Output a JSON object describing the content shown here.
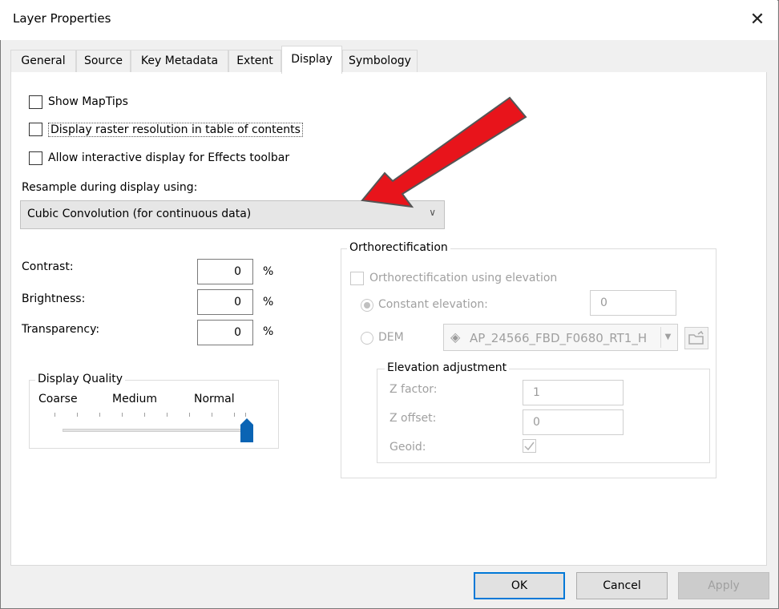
{
  "window": {
    "title": "Layer Properties",
    "close_glyph": "✕"
  },
  "tabs": [
    {
      "label": "General",
      "active": false
    },
    {
      "label": "Source",
      "active": false
    },
    {
      "label": "Key Metadata",
      "active": false
    },
    {
      "label": "Extent",
      "active": false
    },
    {
      "label": "Display",
      "active": true
    },
    {
      "label": "Symbology",
      "active": false
    }
  ],
  "display": {
    "show_maptips": {
      "label": "Show MapTips",
      "checked": false
    },
    "display_resolution": {
      "label": "Display raster resolution in table of contents",
      "checked": false
    },
    "allow_interactive": {
      "label": "Allow interactive display for Effects toolbar",
      "checked": false
    },
    "resample_label": "Resample during display using:",
    "resample_value": "Cubic Convolution (for continuous data)",
    "contrast": {
      "label": "Contrast:",
      "value": "0",
      "unit": "%"
    },
    "brightness": {
      "label": "Brightness:",
      "value": "0",
      "unit": "%"
    },
    "transparency": {
      "label": "Transparency:",
      "value": "0",
      "unit": "%"
    },
    "quality": {
      "group_label": "Display Quality",
      "coarse": "Coarse",
      "medium": "Medium",
      "normal": "Normal",
      "level": 1.0
    }
  },
  "ortho": {
    "group_label": "Orthorectification",
    "using_elevation": {
      "label": "Orthorectification using elevation",
      "checked": false
    },
    "constant_elevation": {
      "label": "Constant elevation:",
      "value": "0",
      "selected": true
    },
    "dem": {
      "label": "DEM",
      "value": "AP_24566_FBD_F0680_RT1_H",
      "selected": false
    },
    "elevation_adjustment": {
      "group_label": "Elevation adjustment",
      "z_factor": {
        "label": "Z factor:",
        "value": "1"
      },
      "z_offset": {
        "label": "Z offset:",
        "value": "0"
      },
      "geoid": {
        "label": "Geoid:",
        "checked": true
      }
    }
  },
  "buttons": {
    "ok": "OK",
    "cancel": "Cancel",
    "apply": "Apply"
  },
  "colors": {
    "arrow": "#e8141b",
    "accent": "#0078d7",
    "slider_thumb": "#0a64b4"
  }
}
